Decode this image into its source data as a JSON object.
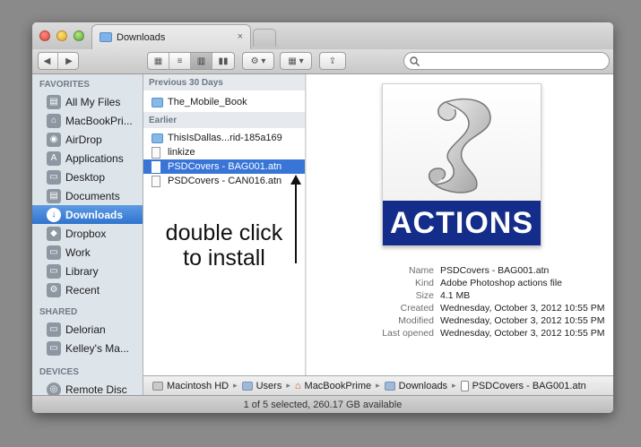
{
  "window": {
    "tab_title": "Downloads",
    "close_glyph": "×"
  },
  "toolbar": {
    "back_glyph": "◀",
    "forward_glyph": "▶",
    "view_icons": [
      "▦",
      "≡",
      "▥",
      "▮▮"
    ],
    "action_glyph": "⚙ ▾",
    "arrange_glyph": "▦ ▾",
    "share_glyph": "⇪",
    "search_placeholder": ""
  },
  "sidebar": {
    "favorites_header": "FAVORITES",
    "shared_header": "SHARED",
    "devices_header": "DEVICES",
    "favorites": [
      {
        "label": "All My Files",
        "icon": "all-files-icon"
      },
      {
        "label": "MacBookPri...",
        "icon": "home-icon"
      },
      {
        "label": "AirDrop",
        "icon": "airdrop-icon"
      },
      {
        "label": "Applications",
        "icon": "applications-icon"
      },
      {
        "label": "Desktop",
        "icon": "desktop-icon"
      },
      {
        "label": "Documents",
        "icon": "documents-icon"
      },
      {
        "label": "Downloads",
        "icon": "downloads-icon"
      },
      {
        "label": "Dropbox",
        "icon": "dropbox-icon"
      },
      {
        "label": "Work",
        "icon": "folder-icon"
      },
      {
        "label": "Library",
        "icon": "folder-icon"
      },
      {
        "label": "Recent",
        "icon": "gear-icon"
      }
    ],
    "shared": [
      {
        "label": "Delorian",
        "icon": "computer-icon"
      },
      {
        "label": "Kelley's Ma...",
        "icon": "computer-icon"
      }
    ],
    "devices": [
      {
        "label": "Remote Disc",
        "icon": "disc-icon"
      }
    ]
  },
  "file_list": {
    "section_previous": "Previous 30 Days",
    "section_earlier": "Earlier",
    "previous_items": [
      {
        "name": "The_Mobile_Book",
        "kind": "folder"
      }
    ],
    "earlier_items": [
      {
        "name": "ThisIsDallas...rid-185a169",
        "kind": "folder"
      },
      {
        "name": "linkize",
        "kind": "doc"
      },
      {
        "name": "PSDCovers - BAG001.atn",
        "kind": "doc"
      },
      {
        "name": "PSDCovers - CAN016.atn",
        "kind": "doc"
      }
    ]
  },
  "preview": {
    "banner_text": "ACTIONS",
    "meta": [
      {
        "key": "Name",
        "value": "PSDCovers - BAG001.atn"
      },
      {
        "key": "Kind",
        "value": "Adobe Photoshop actions file"
      },
      {
        "key": "Size",
        "value": "4.1 MB"
      },
      {
        "key": "Created",
        "value": "Wednesday, October 3, 2012 10:55 PM"
      },
      {
        "key": "Modified",
        "value": "Wednesday, October 3, 2012 10:55 PM"
      },
      {
        "key": "Last opened",
        "value": "Wednesday, October 3, 2012 10:55 PM"
      }
    ]
  },
  "pathbar": {
    "crumbs": [
      "Macintosh HD",
      "Users",
      "MacBookPrime",
      "Downloads",
      "PSDCovers - BAG001.atn"
    ],
    "sep_glyph": "▸"
  },
  "status": {
    "text": "1 of 5 selected, 260.17 GB available"
  },
  "annotation": {
    "line1": "double click",
    "line2": "to install"
  },
  "colors": {
    "selection": "#3875d7",
    "actions_banner": "#142d8a"
  }
}
